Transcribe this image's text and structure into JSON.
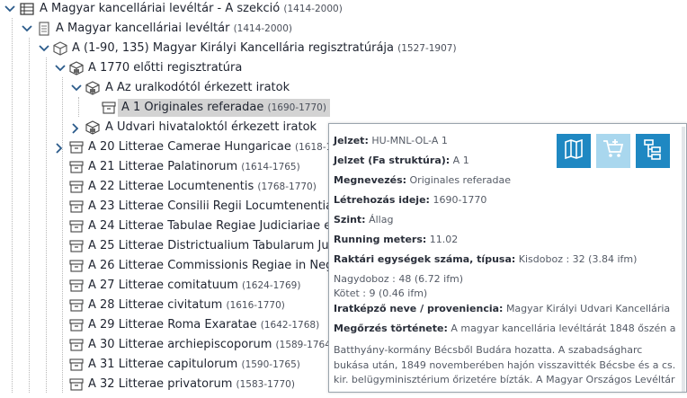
{
  "tree": {
    "root": {
      "label": "A Magyar kancelláriai levéltár - A szekció",
      "years": "(1414-2000)"
    },
    "level1": {
      "label": "A Magyar kancelláriai levéltár",
      "years": "(1414-2000)"
    },
    "level2": {
      "label": "A (1-90, 135) Magyar Királyi Kancellária regisztratúrája",
      "years": "(1527-1907)"
    },
    "level3": {
      "label": "A 1770 előtti regisztratúra",
      "years": ""
    },
    "level4": {
      "label": "A Az uralkodótól érkezett iratok",
      "years": ""
    },
    "selected": {
      "label": "A 1 Originales referadae",
      "years": "(1690-1770)"
    },
    "level4b": {
      "label": "A Udvari hivataloktól érkezett iratok",
      "years": ""
    },
    "items": [
      {
        "label": "A 20 Litterae Camerae Hungaricae",
        "years": "(1618-1…"
      },
      {
        "label": "A 21 Litterae Palatinorum",
        "years": "(1614-1765)"
      },
      {
        "label": "A 22 Litterae Locumtenentis",
        "years": "(1768-1770)"
      },
      {
        "label": "A 23 Litterae Consilii Regii Locumtenentia",
        "years": ""
      },
      {
        "label": "A 24 Litterae Tabulae Regiae Judiciariae e",
        "years": ""
      },
      {
        "label": "A 25 Litterae Districtualium Tabularum Jud",
        "years": ""
      },
      {
        "label": "A 26 Litterae Commissionis Regiae in Neg",
        "years": ""
      },
      {
        "label": "A 27 Litterae comitatuum",
        "years": "(1624-1769)"
      },
      {
        "label": "A 28 Litterae civitatum",
        "years": "(1616-1770)"
      },
      {
        "label": "A 29 Litterae Roma Exaratae",
        "years": "(1642-1768)"
      },
      {
        "label": "A 30 Litterae archiepiscoporum",
        "years": "(1589-1764"
      },
      {
        "label": "A 31 Litterae capitulorum",
        "years": "(1590-1765)"
      },
      {
        "label": "A 32 Litterae privatorum",
        "years": "(1583-1770)"
      }
    ]
  },
  "popup": {
    "jelzet": {
      "label": "Jelzet:",
      "value": "HU-MNL-OL-A 1"
    },
    "jelzet_fa": {
      "label": "Jelzet (Fa struktúra):",
      "value": "A 1"
    },
    "megnevezes": {
      "label": "Megnevezés:",
      "value": "Originales referadae"
    },
    "letrehozas": {
      "label": "Létrehozás ideje:",
      "value": "1690-1770"
    },
    "szint": {
      "label": "Szint:",
      "value": "Állag"
    },
    "running": {
      "label": "Running meters:",
      "value": "11.02"
    },
    "raktari": {
      "label": "Raktári egységek száma, típusa:",
      "value": "Kisdoboz : 32 (3.84 ifm)"
    },
    "raktari_2": "Nagydoboz : 48 (6.72 ifm)",
    "raktari_3": "Kötet : 9 (0.46 ifm)",
    "iratkepzo": {
      "label": "Iratképző neve / proveniencia:",
      "value": "Magyar Királyi Udvari Kancellária"
    },
    "megorzes": {
      "label": "Megőrzés története:",
      "value": "A magyar kancellária levéltárát 1848 őszén a"
    },
    "megorzes_2": "Batthyány-kormány Bécsből Budára hozatta. A szabadságharc",
    "megorzes_3": "bukása után, 1849 novemberében hajón visszavitték Bécsbe és a cs.",
    "megorzes_4": "kir. belügyminisztérium őrizetére bízták. A Magyar Országos Levéltár",
    "colors": {
      "accent": "#1f88c2",
      "accent_light": "#a9d7ee",
      "selected_bg": "#d3d3d3"
    },
    "icons": [
      "map-book-icon",
      "add-to-cart-icon",
      "tree-structure-icon"
    ]
  }
}
